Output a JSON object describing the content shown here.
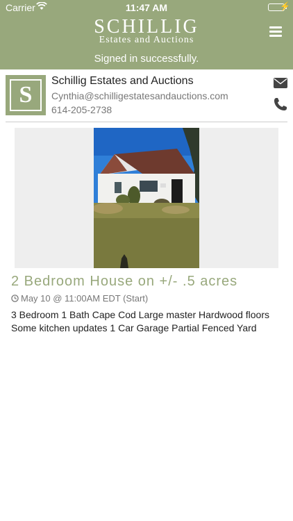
{
  "status_bar": {
    "carrier": "Carrier",
    "time": "11:47 AM",
    "battery_level": 1.0
  },
  "header": {
    "logo_name": "SCHILLIG",
    "logo_sub": "Estates and Auctions",
    "signin_message": "Signed in successfully.",
    "menu_icon": "hamburger-menu-icon"
  },
  "company": {
    "logo_letter": "S",
    "name": "Schillig Estates and Auctions",
    "email": "Cynthia@schilligestatesandauctions.com",
    "phone": "614-205-2738",
    "icons": [
      "envelope-icon",
      "phone-icon"
    ]
  },
  "listing": {
    "title": "2 Bedroom House on +/- .5 acres",
    "date": "May 10 @ 11:00AM EDT (Start)",
    "description": "3 Bedroom 1 Bath Cape Cod Large master Hardwood floors Some kitchen updates 1 Car Garage Partial Fenced Yard"
  },
  "colors": {
    "brand": "#98a87c",
    "text": "#222222",
    "muted": "#777777",
    "photo_bg": "#eeeeee"
  }
}
